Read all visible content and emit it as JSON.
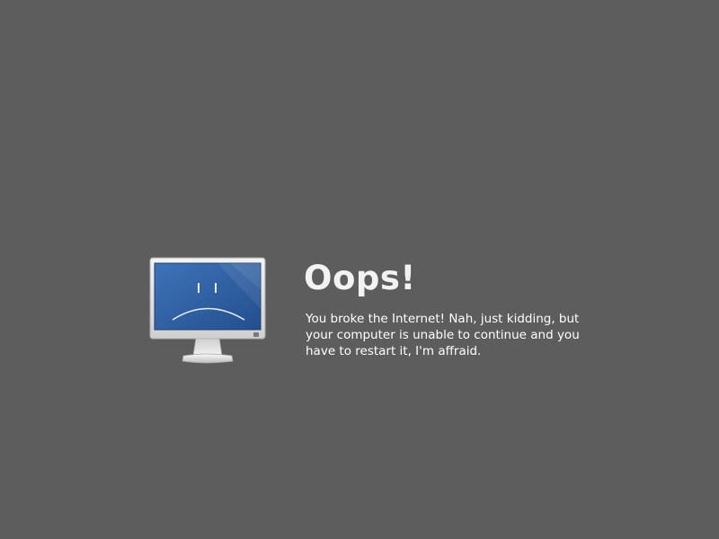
{
  "error": {
    "title": "Oops!",
    "message": "You broke the Internet! Nah, just kidding, but your computer is unable to continue and you have to restart it, I'm affraid.",
    "icon": "sad-computer-icon"
  },
  "colors": {
    "background": "#5d5d5d",
    "text": "#ffffff",
    "screen": "#2f5fa3"
  }
}
